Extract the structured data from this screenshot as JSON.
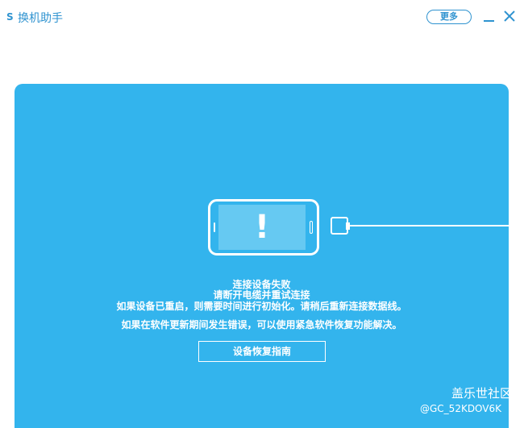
{
  "window": {
    "app_icon": "S",
    "title": "换机助手",
    "more_label": "更多"
  },
  "error": {
    "title": "连接设备失败",
    "line1": "请断开电缆并重试连接",
    "line2": "如果设备已重启，则需要时间进行初始化。请稍后重新连接数据线。",
    "line3": "如果在软件更新期间发生错误，可以使用紧急软件恢复功能解决。",
    "phone_symbol": "!",
    "guide_button": "设备恢复指南"
  },
  "watermark": {
    "line1": "盖乐世社区",
    "line2": "@GC_52KDOV6K"
  },
  "colors": {
    "accent": "#2f93d0",
    "panel": "#33b4ed",
    "phone_screen": "#66c9f2"
  }
}
